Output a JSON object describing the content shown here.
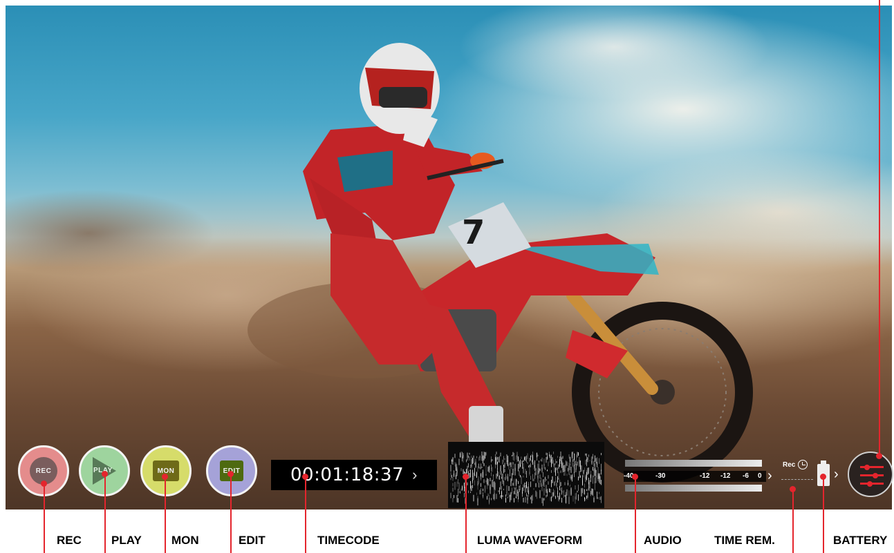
{
  "buttons": {
    "rec": "REC",
    "play": "PLAY",
    "mon": "MON",
    "edit": "EDIT"
  },
  "timecode": {
    "value": "00:01:18:37",
    "chevron": "›"
  },
  "audio": {
    "scale": [
      "-40",
      "-30",
      "-12",
      "-12",
      "-6",
      "0"
    ],
    "chevron": "›"
  },
  "time_remaining": {
    "label": "Rec"
  },
  "battery": {
    "chevron": "›"
  },
  "callouts": {
    "rec": "REC",
    "play": "PLAY",
    "mon": "MON",
    "edit": "EDIT",
    "timecode": "TIMECODE",
    "luma_waveform": "LUMA WAVEFORM",
    "audio": "AUDIO",
    "time_rem": "TIME REM.",
    "battery": "BATTERY"
  },
  "colors": {
    "accent": "#e4252d",
    "rec": "#e48c8c",
    "play": "#9ed49e",
    "mon": "#d6dc6a",
    "edit": "#a5a2d8"
  }
}
